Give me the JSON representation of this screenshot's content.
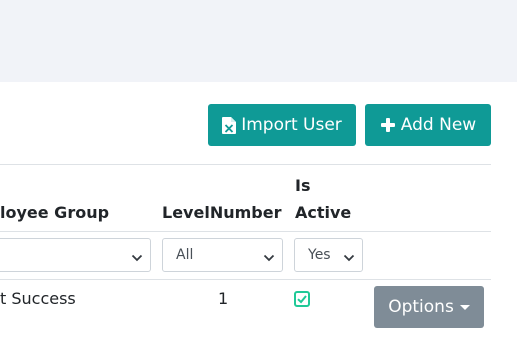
{
  "toolbar": {
    "import_label": "Import User",
    "add_label": "Add New",
    "button_color": "#0f9a96"
  },
  "table": {
    "headers": {
      "employee_group": "loyee Group",
      "level_number": "LevelNumber",
      "is_active_line1": "Is",
      "is_active_line2": "Active"
    },
    "filters": {
      "employee_group": "",
      "level_number": "All",
      "is_active": "Yes"
    },
    "rows": [
      {
        "employee_group": "t Success",
        "level_number": "1",
        "is_active": true,
        "options_label": "Options"
      }
    ]
  },
  "icons": {
    "import": "excel-file-icon",
    "add": "plus-icon",
    "active": "checkbox-checked-icon",
    "options": "caret-down-icon"
  },
  "colors": {
    "accent": "#0f9a96",
    "options_button": "#7f8c97",
    "check": "#20c997"
  }
}
